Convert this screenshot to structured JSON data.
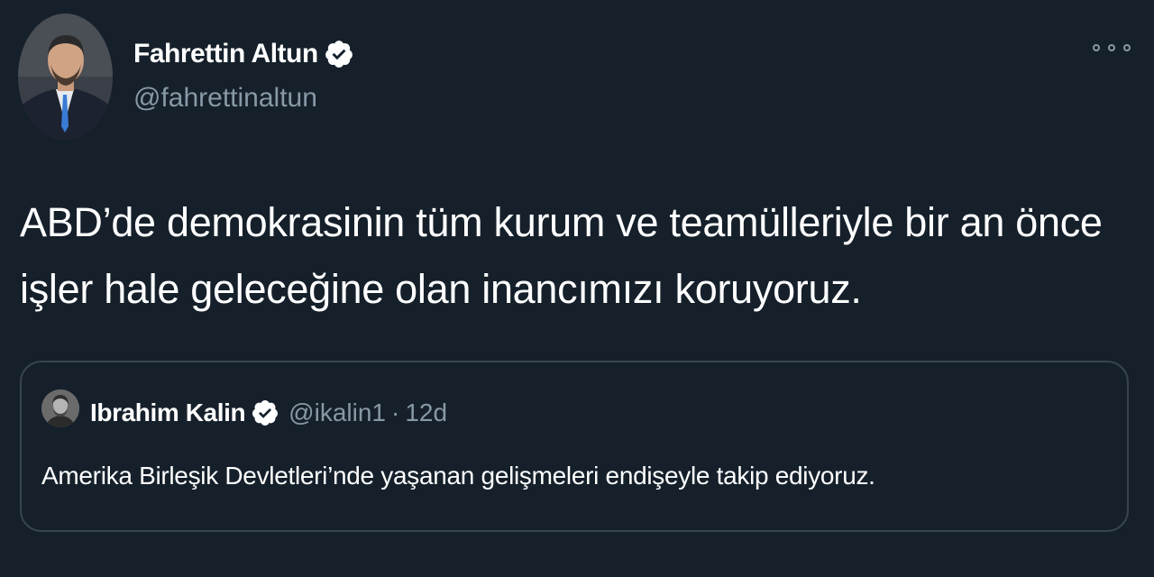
{
  "tweet": {
    "author": {
      "display_name": "Fahrettin Altun",
      "handle": "@fahrettinaltun",
      "verified_icon": "verified-badge-icon"
    },
    "more_icon": "more-options-icon",
    "text": "ABD’de demokrasinin tüm kurum ve teamülleriyle bir an önce işler hale geleceğine olan inancımızı koruyoruz.",
    "quoted": {
      "display_name": "Ibrahim Kalin",
      "handle": "@ikalin1",
      "separator": "·",
      "time": "12d",
      "verified_icon": "verified-badge-icon",
      "text": "Amerika Birleşik Devletleri’nde yaşanan gelişmeleri endişeyle takip ediyoruz."
    }
  },
  "colors": {
    "background": "#15202b",
    "secondary_text": "#8899a6",
    "border": "#38444d",
    "primary_text": "#ffffff"
  }
}
